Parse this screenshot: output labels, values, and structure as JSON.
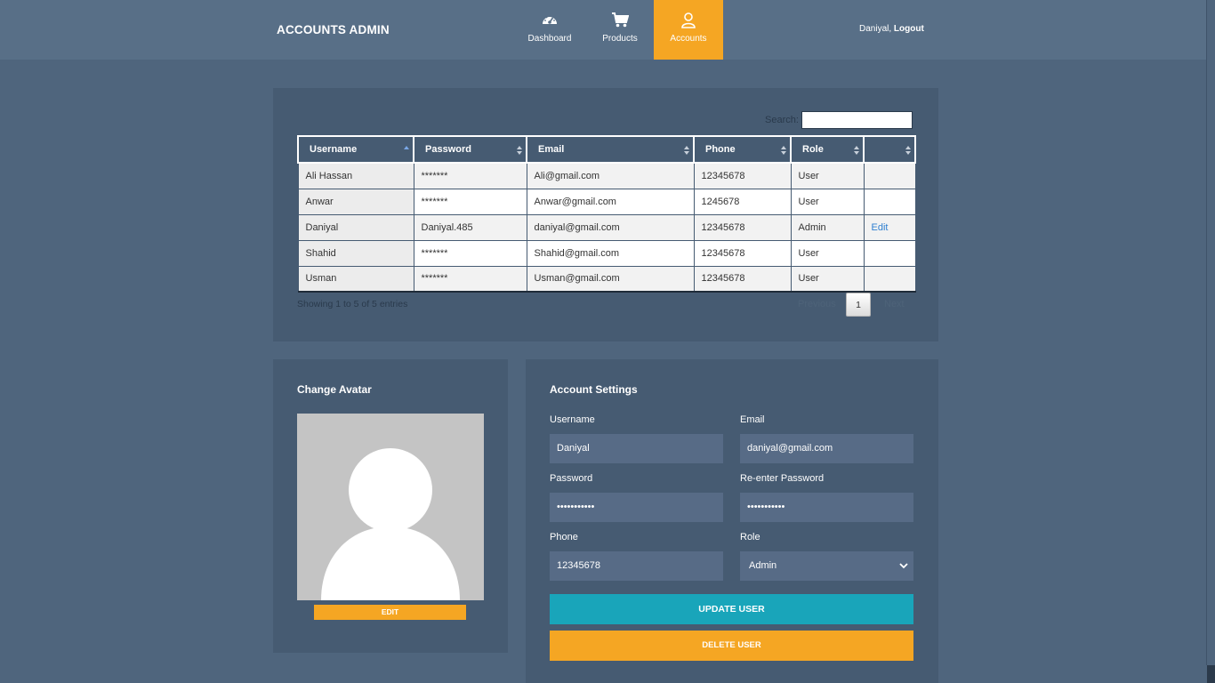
{
  "header": {
    "brand": "ACCOUNTS ADMIN",
    "nav": [
      {
        "label": "Dashboard",
        "icon": "speedometer-icon"
      },
      {
        "label": "Products",
        "icon": "cart-icon"
      },
      {
        "label": "Accounts",
        "icon": "user-icon",
        "active": true
      }
    ],
    "user_name": "Daniyal,",
    "logout_label": "Logout"
  },
  "colors": {
    "accent": "#f5a623",
    "update_button": "#19a5ba",
    "background": "#4f657d",
    "panel": "#465b72"
  },
  "table": {
    "search_label": "Search:",
    "search_value": "",
    "columns": [
      "Username",
      "Password",
      "Email",
      "Phone",
      "Role",
      ""
    ],
    "rows": [
      [
        "Ali Hassan",
        "*******",
        "Ali@gmail.com",
        "12345678",
        "User",
        ""
      ],
      [
        "Anwar",
        "*******",
        "Anwar@gmail.com",
        "1245678",
        "User",
        ""
      ],
      [
        "Daniyal",
        "Daniyal.485",
        "daniyal@gmail.com",
        "12345678",
        "Admin",
        "Edit"
      ],
      [
        "Shahid",
        "*******",
        "Shahid@gmail.com",
        "12345678",
        "User",
        ""
      ],
      [
        "Usman",
        "*******",
        "Usman@gmail.com",
        "12345678",
        "User",
        ""
      ]
    ],
    "info": "Showing 1 to 5 of 5 entries",
    "pagination": {
      "previous": "Previous",
      "current_page": "1",
      "next": "Next"
    }
  },
  "avatar_panel": {
    "title": "Change Avatar",
    "edit_label": "EDIT"
  },
  "settings": {
    "title": "Account Settings",
    "username_label": "Username",
    "username_value": "Daniyal",
    "email_label": "Email",
    "email_value": "daniyal@gmail.com",
    "password_label": "Password",
    "password_value": "•••••••••••",
    "reenter_label": "Re-enter Password",
    "reenter_value": "•••••••••••",
    "phone_label": "Phone",
    "phone_value": "12345678",
    "role_label": "Role",
    "role_value": "Admin",
    "update_label": "UPDATE USER",
    "delete_label": "DELETE USER"
  }
}
